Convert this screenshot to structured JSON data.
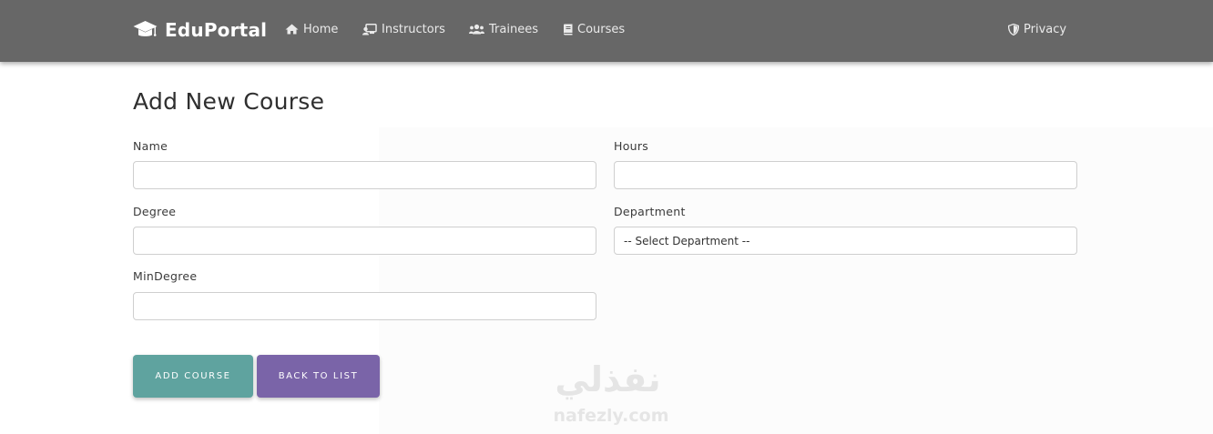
{
  "navbar": {
    "brand": "EduPortal",
    "brand_icon": "graduation-cap-icon",
    "items": [
      {
        "label": "Home",
        "icon": "home-icon"
      },
      {
        "label": "Instructors",
        "icon": "instructor-icon"
      },
      {
        "label": "Trainees",
        "icon": "users-icon"
      },
      {
        "label": "Courses",
        "icon": "book-icon"
      }
    ],
    "privacy": {
      "label": "Privacy",
      "icon": "shield-icon"
    },
    "background_color": "#676767"
  },
  "page": {
    "title": "Add New Course"
  },
  "form": {
    "name": {
      "label": "Name",
      "value": ""
    },
    "hours": {
      "label": "Hours",
      "value": ""
    },
    "degree": {
      "label": "Degree",
      "value": ""
    },
    "department": {
      "label": "Department",
      "selected": "-- Select Department --"
    },
    "min_degree": {
      "label": "MinDegree",
      "value": ""
    }
  },
  "actions": {
    "add_label": "Add Course",
    "add_color": "#5fa39f",
    "back_label": "Back to List",
    "back_color": "#7a64a8"
  },
  "watermark": {
    "arabic": "نفذلي",
    "latin": "nafezly.com"
  }
}
